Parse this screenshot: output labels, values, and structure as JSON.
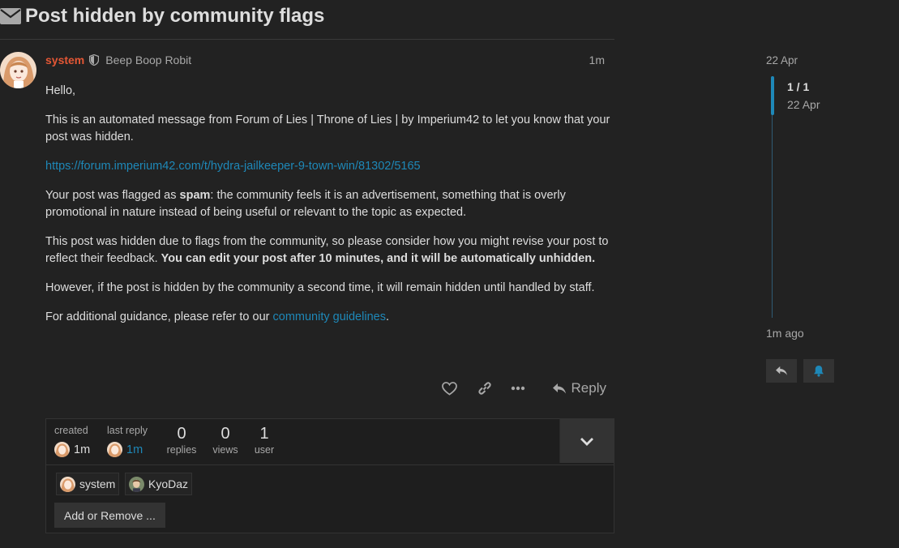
{
  "topic": {
    "title": "Post hidden by community flags"
  },
  "post": {
    "username": "system",
    "user_title": "Beep Boop Robit",
    "date": "1m",
    "greeting": "Hello,",
    "p1": "This is an automated message from Forum of Lies | Throne of Lies | by Imperium42 to let you know that your post was hidden.",
    "link": "https://forum.imperium42.com/t/hydra-jailkeeper-9-town-win/81302/5165",
    "p3_a": "Your post was flagged as ",
    "p3_b": "spam",
    "p3_c": ": the community feels it is an advertisement, something that is overly promotional in nature instead of being useful or relevant to the topic as expected.",
    "p4_a": "This post was hidden due to flags from the community, so please consider how you might revise your post to reflect their feedback. ",
    "p4_b": "You can edit your post after 10 minutes, and it will be automatically unhidden.",
    "p5": "However, if the post is hidden by the community a second time, it will remain hidden until handled by staff.",
    "p6_a": "For additional guidance, please refer to our ",
    "p6_link": "community guidelines",
    "p6_b": "."
  },
  "actions": {
    "reply_label": "Reply"
  },
  "topic_map": {
    "created_label": "created",
    "created_value": "1m",
    "last_reply_label": "last reply",
    "last_reply_value": "1m",
    "replies_count": "0",
    "replies_label": "replies",
    "views_count": "0",
    "views_label": "views",
    "users_count": "1",
    "users_label": "user",
    "participants": [
      "system",
      "KyoDaz"
    ],
    "add_remove_label": "Add or Remove ..."
  },
  "timeline": {
    "top_date": "22 Apr",
    "position": "1 / 1",
    "position_date": "22 Apr",
    "bottom_label": "1m ago"
  },
  "colors": {
    "accent": "#1e88b8",
    "username": "#e45735",
    "background": "#222222"
  }
}
